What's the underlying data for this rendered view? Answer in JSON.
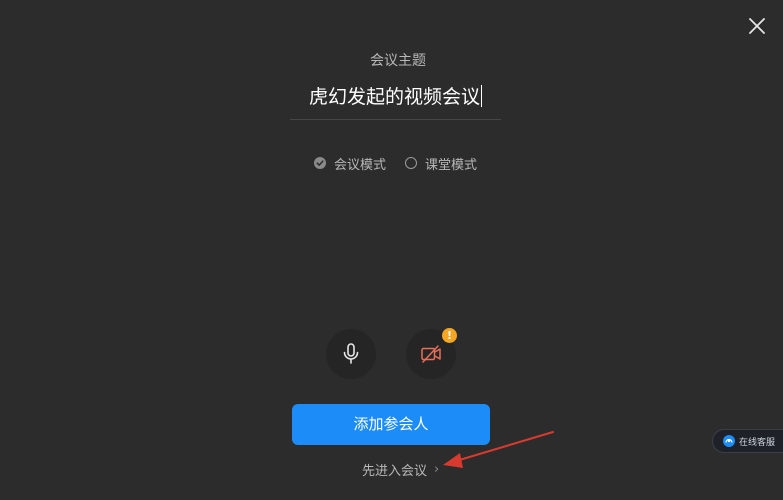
{
  "dialog": {
    "meeting_label": "会议主题",
    "meeting_title": "虎幻发起的视频会议",
    "modes": [
      {
        "label": "会议模式",
        "selected": true
      },
      {
        "label": "课堂模式",
        "selected": false
      }
    ],
    "microphone_icon": "microphone-icon",
    "camera_icon": "camera-off-icon",
    "camera_warning_badge": "!",
    "add_participants_label": "添加参会人",
    "enter_meeting_label": "先进入会议",
    "enter_meeting_chevron": "›"
  },
  "online_service": {
    "label": "在线客服",
    "icon": "service-icon"
  },
  "colors": {
    "background": "#2c2c2c",
    "primary": "#1b8cf8",
    "warning": "#f5a623",
    "annotation_arrow": "#d93a2f"
  }
}
